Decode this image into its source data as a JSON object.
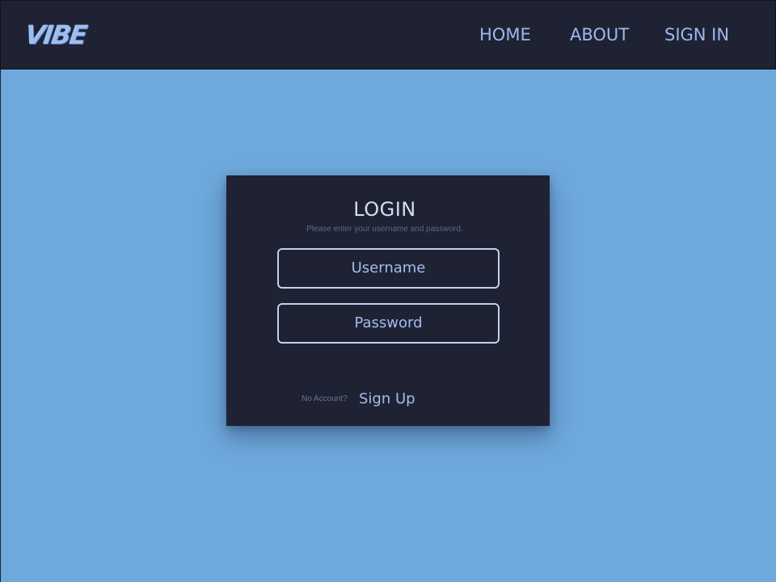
{
  "header": {
    "logo_text": "VIBE",
    "nav": {
      "home": "HOME",
      "about": "ABOUT",
      "sign_in": "SIGN IN"
    }
  },
  "login": {
    "title": "LOGIN",
    "subtitle": "Please enter your username and password.",
    "username_placeholder": "Username",
    "password_placeholder": "Password",
    "no_account_text": "No Account?",
    "signup_label": "Sign Up"
  },
  "colors": {
    "background": "#6ea8dc",
    "panel": "#1f2233",
    "accent": "#a3bcee",
    "field_border": "#c3cfee"
  }
}
